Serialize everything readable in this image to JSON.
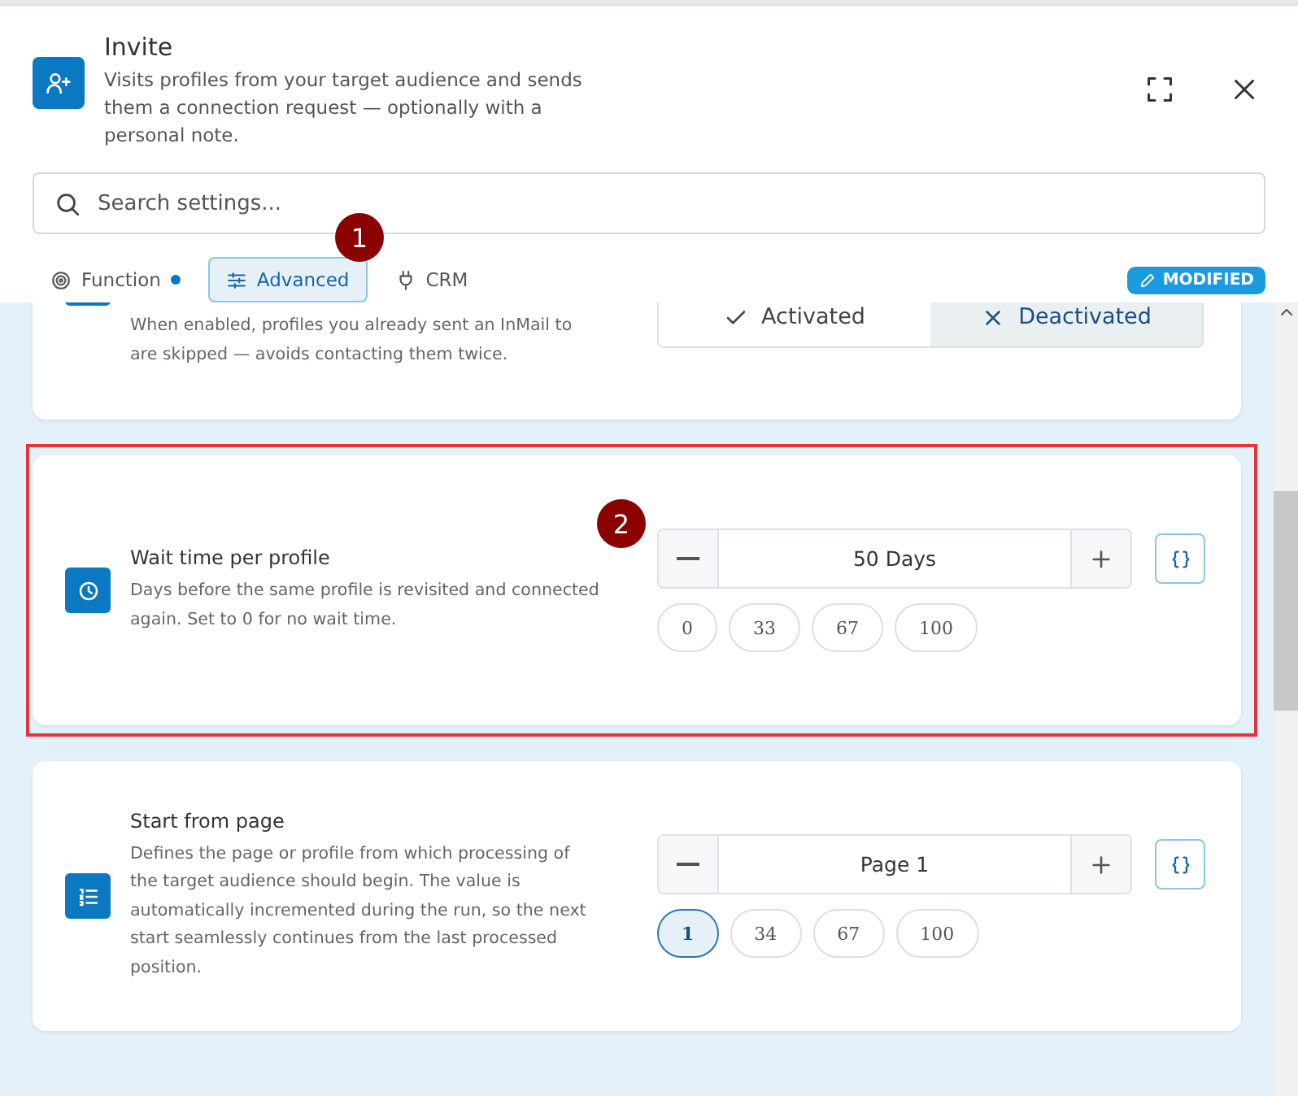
{
  "header": {
    "title": "Invite",
    "description": "Visits profiles from your target audience and sends them a connection request — optionally with a personal note."
  },
  "search": {
    "placeholder": "Search settings..."
  },
  "tabs": [
    {
      "label": "Function",
      "selected": false,
      "dot": true
    },
    {
      "label": "Advanced",
      "selected": true,
      "dot": false
    },
    {
      "label": "CRM",
      "selected": false,
      "dot": false
    }
  ],
  "status_badge": "MODIFIED",
  "callouts": [
    "1",
    "2"
  ],
  "cards": [
    {
      "kind": "toggle",
      "description": "When enabled, profiles you already sent an InMail to are skipped — avoids contacting them twice.",
      "options": [
        {
          "label": "Activated",
          "selected": false
        },
        {
          "label": "Deactivated",
          "selected": true
        }
      ],
      "highlighted": false
    },
    {
      "kind": "stepper",
      "title": "Wait time per profile",
      "description": "Days before the same profile is revisited and connected again. Set to 0 for no wait time.",
      "value": "50 Days",
      "presets": [
        {
          "label": "0",
          "selected": false
        },
        {
          "label": "33",
          "selected": false
        },
        {
          "label": "67",
          "selected": false
        },
        {
          "label": "100",
          "selected": false
        }
      ],
      "highlighted": true
    },
    {
      "kind": "stepper",
      "title": "Start from page",
      "description": "Defines the page or profile from which processing of the target audience should begin. The value is automatically incremented during the run, so the next start seamlessly continues from the last processed position.",
      "value": "Page 1",
      "presets": [
        {
          "label": "1",
          "selected": true
        },
        {
          "label": "34",
          "selected": false
        },
        {
          "label": "67",
          "selected": false
        },
        {
          "label": "100",
          "selected": false
        }
      ],
      "highlighted": false
    }
  ]
}
